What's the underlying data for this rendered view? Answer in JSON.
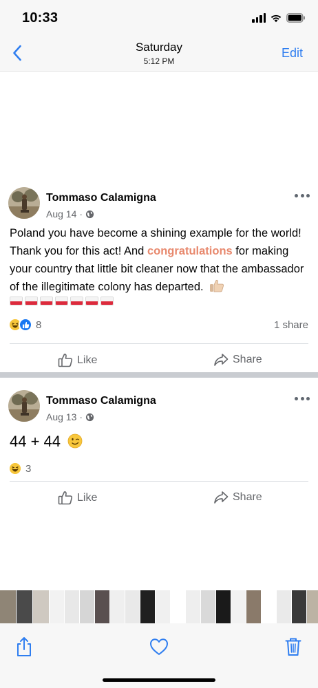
{
  "status_bar": {
    "time": "10:33"
  },
  "nav": {
    "title": "Saturday",
    "subtitle": "5:12 PM",
    "edit_label": "Edit"
  },
  "posts": [
    {
      "author": "Tommaso Calamigna",
      "date": "Aug 14",
      "text_before": "Poland you have become a shining example for the world! Thank you for this act! And ",
      "text_highlight": "congratulations",
      "text_after": " for making your country that little bit cleaner now that the ambassador of the illegitimate colony has departed.",
      "flag_count": 7,
      "reaction_count": "8",
      "shares": "1 share",
      "like_label": "Like",
      "share_label": "Share"
    },
    {
      "author": "Tommaso Calamigna",
      "date": "Aug 13",
      "text": "44 + 44",
      "reaction_count": "3",
      "like_label": "Like",
      "share_label": "Share"
    }
  ],
  "icons": {
    "back": "chevron-left-icon",
    "more": "ellipsis-icon",
    "privacy": "globe-icon",
    "reaction_haha": "haha-emoji-icon",
    "reaction_like": "like-reaction-icon",
    "like": "thumbs-up-outline-icon",
    "share": "share-arrow-icon",
    "toolbar_share": "share-box-icon",
    "toolbar_favorite": "heart-icon",
    "toolbar_delete": "trash-icon"
  },
  "colors": {
    "accent": "#2f7ef0",
    "highlight": "#e8896e",
    "secondary_text": "#65676b",
    "flag_red": "#dc2a3c"
  },
  "thumbnails": [
    "#8f8576",
    "#4a4a4a",
    "#cfc9c1",
    "#f2f2f2",
    "#e8e8e8",
    "#d6d6d6",
    "#5a5050",
    "#efefef",
    "#e9e9e9",
    "#202020",
    "#f0f0f0",
    "#ffffff",
    "#eeeeee",
    "#d9d9d9",
    "#1a1a1a",
    "#f2f2f2",
    "#8a7a6a",
    "#ffffff",
    "#eaeaea",
    "#3a3a3a",
    "#bcb3a4",
    "#7c6c5c"
  ]
}
